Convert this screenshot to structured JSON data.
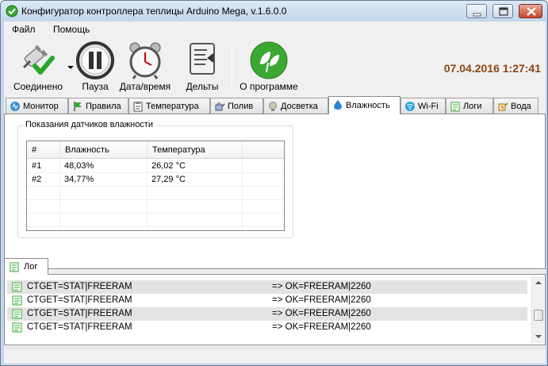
{
  "window": {
    "title": "Конфигуратор контроллера теплицы Arduino Mega, v.1.6.0.0"
  },
  "menu": {
    "file": "Файл",
    "help": "Помощь"
  },
  "toolbar": {
    "connected_label": "Соединено",
    "pause_label": "Пауза",
    "datetime_label": "Дата/время",
    "deltas_label": "Дельты",
    "about_label": "О программе",
    "clock": "07.04.2016 1:27:41"
  },
  "tabs": [
    {
      "label": "Монитор",
      "icon": "monitor-icon"
    },
    {
      "label": "Правила",
      "icon": "flag-icon"
    },
    {
      "label": "Температура",
      "icon": "clipboard-icon"
    },
    {
      "label": "Полив",
      "icon": "watering-icon"
    },
    {
      "label": "Досветка",
      "icon": "bulb-icon"
    },
    {
      "label": "Влажность",
      "icon": "drop-icon",
      "active": true
    },
    {
      "label": "Wi-Fi",
      "icon": "wifi-icon"
    },
    {
      "label": "Логи",
      "icon": "log-icon"
    },
    {
      "label": "Вода",
      "icon": "water-icon"
    }
  ],
  "humidity": {
    "group_title": "Показания датчиков влажности",
    "columns": [
      "#",
      "Влажность",
      "Температура"
    ],
    "rows": [
      {
        "id": "#1",
        "humidity": "48,03%",
        "temperature": "26,02 °C"
      },
      {
        "id": "#2",
        "humidity": "34,77%",
        "temperature": "27,29 °C"
      }
    ]
  },
  "log": {
    "tab_label": "Лог",
    "entries": [
      {
        "command": "CTGET=STAT|FREERAM",
        "response": "=> OK=FREERAM|2260"
      },
      {
        "command": "CTGET=STAT|FREERAM",
        "response": "=> OK=FREERAM|2260"
      },
      {
        "command": "CTGET=STAT|FREERAM",
        "response": "=> OK=FREERAM|2260"
      },
      {
        "command": "CTGET=STAT|FREERAM",
        "response": "=> OK=FREERAM|2260"
      }
    ]
  },
  "colors": {
    "clock": "#8b4513",
    "accent_green": "#3aa832"
  }
}
